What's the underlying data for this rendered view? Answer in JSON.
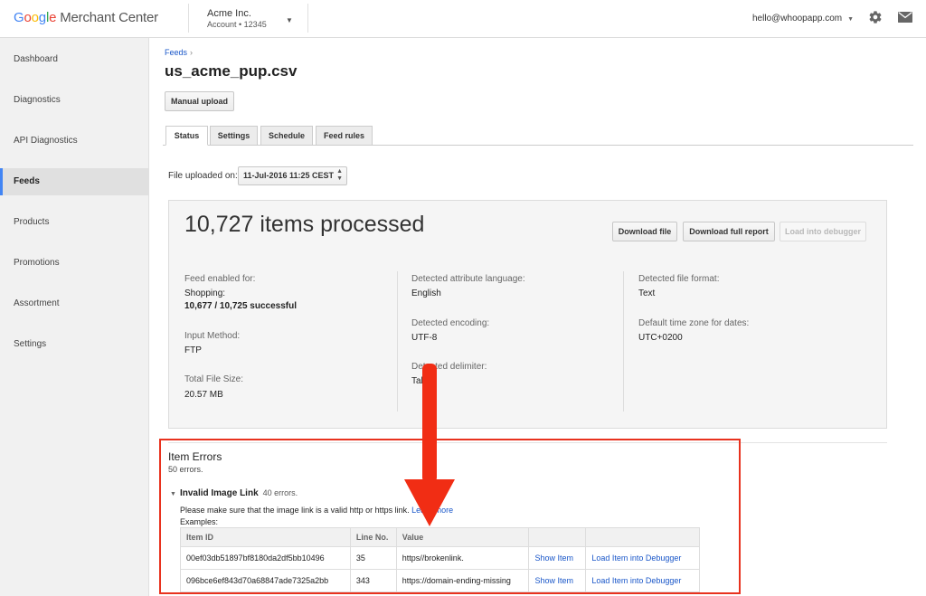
{
  "header": {
    "logo_google": [
      "G",
      "o",
      "o",
      "g",
      "l",
      "e"
    ],
    "logo_rest": "Merchant Center",
    "account_name": "Acme Inc.",
    "account_label": "Account  •  12345",
    "user_email": "hello@whoopapp.com"
  },
  "sidebar": {
    "items": [
      {
        "label": "Dashboard"
      },
      {
        "label": "Diagnostics"
      },
      {
        "label": "API Diagnostics"
      },
      {
        "label": "Feeds"
      },
      {
        "label": "Products"
      },
      {
        "label": "Promotions"
      },
      {
        "label": "Assortment"
      },
      {
        "label": "Settings"
      }
    ],
    "active": "Feeds"
  },
  "breadcrumb": {
    "parent": "Feeds",
    "sep": "›"
  },
  "page_title": "us_acme_pup.csv",
  "manual_upload_label": "Manual upload",
  "tabs": [
    {
      "label": "Status"
    },
    {
      "label": "Settings"
    },
    {
      "label": "Schedule"
    },
    {
      "label": "Feed rules"
    }
  ],
  "upload": {
    "label": "File uploaded on:",
    "selected": "11-Jul-2016 11:25 CEST"
  },
  "summary": {
    "headline": "10,727 items processed",
    "buttons": {
      "download_file": "Download file",
      "download_report": "Download full report",
      "load_debugger": "Load into debugger"
    },
    "feed_enabled_label": "Feed enabled for:",
    "feed_enabled_dest": "Shopping:",
    "feed_enabled_value": "10,677 / 10,725 successful",
    "input_method_label": "Input Method:",
    "input_method_value": "FTP",
    "total_size_label": "Total File Size:",
    "total_size_value": "20.57 MB",
    "attr_lang_label": "Detected attribute language:",
    "attr_lang_value": "English",
    "encoding_label": "Detected encoding:",
    "encoding_value": "UTF-8",
    "delimiter_label": "Detected delimiter:",
    "delimiter_value": "Tab",
    "file_format_label": "Detected file format:",
    "file_format_value": "Text",
    "timezone_label": "Default time zone for dates:",
    "timezone_value": "UTC+0200"
  },
  "errors": {
    "title": "Item Errors",
    "count": "50 errors.",
    "issue_name": "Invalid Image Link",
    "issue_count": "40 errors.",
    "hint_text": "Please make sure that the image link is a valid http or https link.",
    "hint_link": "Learn more",
    "examples_label": "Examples:",
    "columns": [
      "Item ID",
      "Line No.",
      "Value",
      "",
      ""
    ],
    "rows": [
      {
        "item_id": "00ef03db51897bf8180da2df5bb10496",
        "line": "35",
        "value": "https//brokenlink.",
        "show": "Show Item",
        "load": "Load Item into Debugger"
      },
      {
        "item_id": "096bce6ef843d70a68847ade7325a2bb",
        "line": "343",
        "value": "https://domain-ending-missing",
        "show": "Show Item",
        "load": "Load Item into Debugger"
      }
    ]
  },
  "colors": {
    "link": "#1a57c9",
    "highlight_red": "#e8321e",
    "active_nav_border": "#4285f4"
  }
}
